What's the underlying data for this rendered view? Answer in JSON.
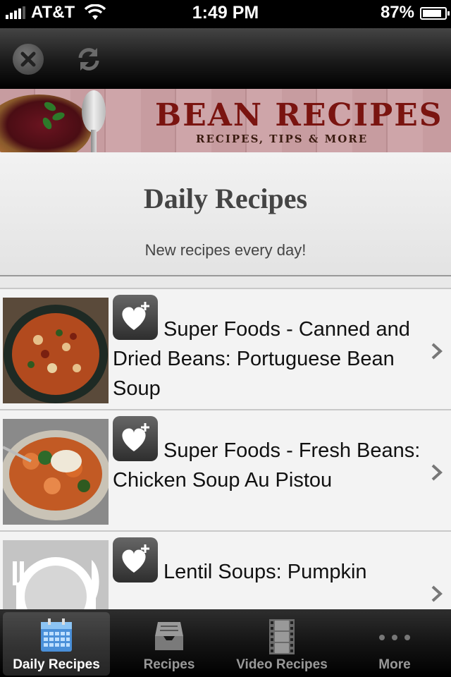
{
  "status_bar": {
    "carrier": "AT&T",
    "time": "1:49 PM",
    "battery_percent": "87%",
    "battery_level": 0.87,
    "icons": [
      "signal-icon",
      "wifi-icon",
      "battery-icon"
    ]
  },
  "toolbar": {
    "icons": [
      "close-icon",
      "refresh-icon"
    ]
  },
  "banner": {
    "title": "BEAN RECIPES",
    "subtitle": "RECIPES, TIPS & MORE"
  },
  "header": {
    "title": "Daily Recipes",
    "subtitle": "New recipes every day!"
  },
  "recipes": [
    {
      "title": "Super Foods - Canned and Dried Beans: Portuguese Bean Soup",
      "icon": "favorite-add-icon"
    },
    {
      "title": "Super Foods - Fresh Beans: Chicken Soup Au Pistou",
      "icon": "favorite-add-icon"
    },
    {
      "title": "Lentil Soups: Pumpkin",
      "icon": "favorite-add-icon"
    }
  ],
  "tabs": [
    {
      "label": "Daily Recipes",
      "icon": "calendar-icon",
      "active": true
    },
    {
      "label": "Recipes",
      "icon": "inbox-icon",
      "active": false
    },
    {
      "label": "Video Recipes",
      "icon": "film-icon",
      "active": false
    },
    {
      "label": "More",
      "icon": "more-icon",
      "active": false
    }
  ],
  "colors": {
    "banner_title": "#7a1410",
    "active_tab_icon": "#5aa9ef"
  }
}
